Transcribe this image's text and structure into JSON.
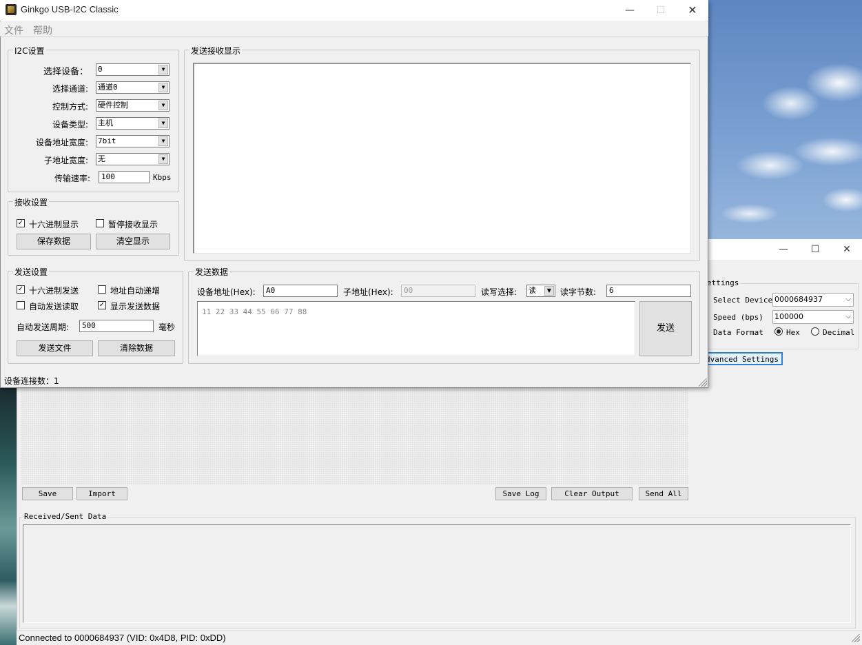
{
  "back_window": {
    "caption": {
      "minimize": "—",
      "maximize": "☐",
      "close": "✕"
    },
    "settings": {
      "group_title": "ettings",
      "select_device_label": "Select Device",
      "select_device_value": "0000684937",
      "speed_label": "Speed (bps)",
      "speed_value": "100000",
      "data_format_label": "Data Format",
      "format_options": [
        "Hex",
        "Decimal"
      ],
      "format_selected": "Hex"
    },
    "advanced_settings_button": "dvanced Settings",
    "buttons": {
      "save": "Save",
      "import": "Import",
      "save_log": "Save Log",
      "clear_output": "Clear Output",
      "send_all": "Send All"
    },
    "received_sent_title": "Received/Sent Data",
    "status_text": "Connected to 0000684937 (VID: 0x4D8, PID: 0xDD)"
  },
  "front_window": {
    "title": "Ginkgo USB-I2C Classic",
    "caption": {
      "minimize": "—",
      "maximize": "☐",
      "close": "✕"
    },
    "menu": [
      "文件",
      "帮助"
    ],
    "i2c_settings": {
      "title": "I2C设置",
      "rows": [
        {
          "label": "选择设备：",
          "value": "0"
        },
        {
          "label": "选择通道:",
          "value": "通道0"
        },
        {
          "label": "控制方式:",
          "value": "硬件控制"
        },
        {
          "label": "设备类型:",
          "value": "主机"
        },
        {
          "label": "设备地址宽度:",
          "value": "7bit"
        },
        {
          "label": "子地址宽度:",
          "value": "无"
        }
      ],
      "rate_label": "传输速率:",
      "rate_value": "100",
      "rate_unit": "Kbps"
    },
    "receive_settings": {
      "title": "接收设置",
      "hex_display": {
        "label": "十六进制显示",
        "checked": true
      },
      "pause_display": {
        "label": "暂停接收显示",
        "checked": false
      },
      "save_button": "保存数据",
      "clear_button": "清空显示"
    },
    "display_title": "发送接收显示",
    "send_settings": {
      "title": "发送设置",
      "hex_send": {
        "label": "十六进制发送",
        "checked": true
      },
      "addr_auto_inc": {
        "label": "地址自动递增",
        "checked": false
      },
      "auto_send_read": {
        "label": "自动发送读取",
        "checked": false
      },
      "show_send_data": {
        "label": "显示发送数据",
        "checked": true
      },
      "period_label": "自动发送周期:",
      "period_value": "500",
      "period_unit": "毫秒",
      "send_file_button": "发送文件",
      "clear_data_button": "清除数据"
    },
    "send_data": {
      "title": "发送数据",
      "device_addr_label": "设备地址(Hex):",
      "device_addr_value": "A0",
      "sub_addr_label": "子地址(Hex):",
      "sub_addr_value": "00",
      "rw_label": "读写选择:",
      "rw_value": "读",
      "read_bytes_label": "读字节数:",
      "read_bytes_value": "6",
      "data_text": "11 22 33 44 55 66 77 88",
      "send_button": "发送"
    },
    "status_text": "设备连接数：1"
  }
}
